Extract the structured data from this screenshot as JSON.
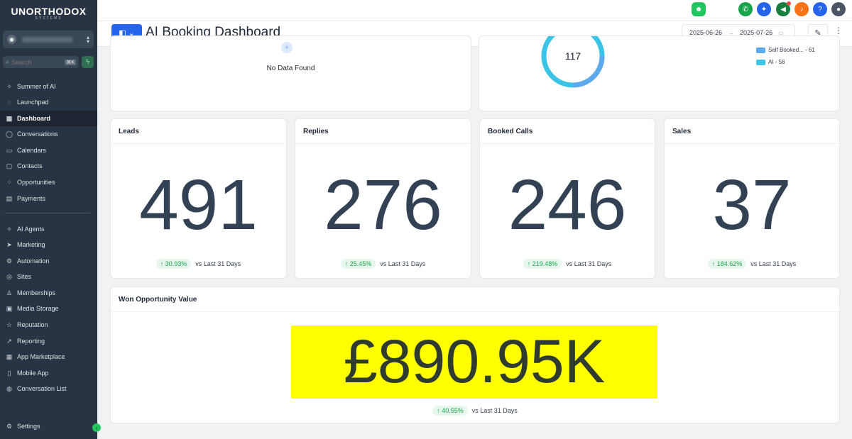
{
  "brand": {
    "name": "UNORTHODOX",
    "tagline": "SYSTEMS"
  },
  "search": {
    "placeholder": "Search",
    "shortcut": "⌘K"
  },
  "sidebar": {
    "items": [
      {
        "label": "Summer of AI",
        "icon": "sparkle-icon"
      },
      {
        "label": "Launchpad",
        "icon": "rocket-icon"
      },
      {
        "label": "Dashboard",
        "icon": "grid-icon",
        "active": true
      },
      {
        "label": "Conversations",
        "icon": "chat-icon"
      },
      {
        "label": "Calendars",
        "icon": "calendar-icon"
      },
      {
        "label": "Contacts",
        "icon": "contacts-icon"
      },
      {
        "label": "Opportunities",
        "icon": "opportunities-icon"
      },
      {
        "label": "Payments",
        "icon": "payments-icon"
      },
      {
        "label": "AI Agents",
        "icon": "ai-agents-icon"
      },
      {
        "label": "Marketing",
        "icon": "send-icon"
      },
      {
        "label": "Automation",
        "icon": "automation-icon"
      },
      {
        "label": "Sites",
        "icon": "globe-icon"
      },
      {
        "label": "Memberships",
        "icon": "membership-icon"
      },
      {
        "label": "Media Storage",
        "icon": "image-icon"
      },
      {
        "label": "Reputation",
        "icon": "star-icon"
      },
      {
        "label": "Reporting",
        "icon": "trend-icon"
      },
      {
        "label": "App Marketplace",
        "icon": "apps-icon"
      },
      {
        "label": "Mobile App",
        "icon": "phone-icon"
      },
      {
        "label": "Conversation List",
        "icon": "conversation-list-icon"
      }
    ],
    "settings_label": "Settings"
  },
  "header": {
    "title": "AI Booking Dashboard",
    "date_start": "2025-06-26",
    "date_end": "2025-07-26"
  },
  "top_cards": {
    "no_data_text": "No Data Found",
    "donut_total": "117",
    "legend": [
      {
        "label": "Self Booked... - 61",
        "color": "#5ea8ec"
      },
      {
        "label": "AI - 56",
        "color": "#3cc4e6"
      }
    ]
  },
  "metrics": [
    {
      "title": "Leads",
      "value": "491",
      "change": "↑ 30.93%",
      "compare": "vs Last 31 Days"
    },
    {
      "title": "Replies",
      "value": "276",
      "change": "↑ 25.45%",
      "compare": "vs Last 31 Days"
    },
    {
      "title": "Booked Calls",
      "value": "246",
      "change": "↑ 219.48%",
      "compare": "vs Last 31 Days"
    },
    {
      "title": "Sales",
      "value": "37",
      "change": "↑ 184.62%",
      "compare": "vs Last 31 Days"
    }
  ],
  "won": {
    "title": "Won Opportunity Value",
    "value": "£890.95K",
    "change": "↑ 40.55%",
    "compare": "vs Last 31 Days"
  },
  "colors": {
    "sidebar_bg": "#283443",
    "accent": "#2563eb",
    "positive": "#16a34a",
    "highlight": "#ffff00"
  }
}
